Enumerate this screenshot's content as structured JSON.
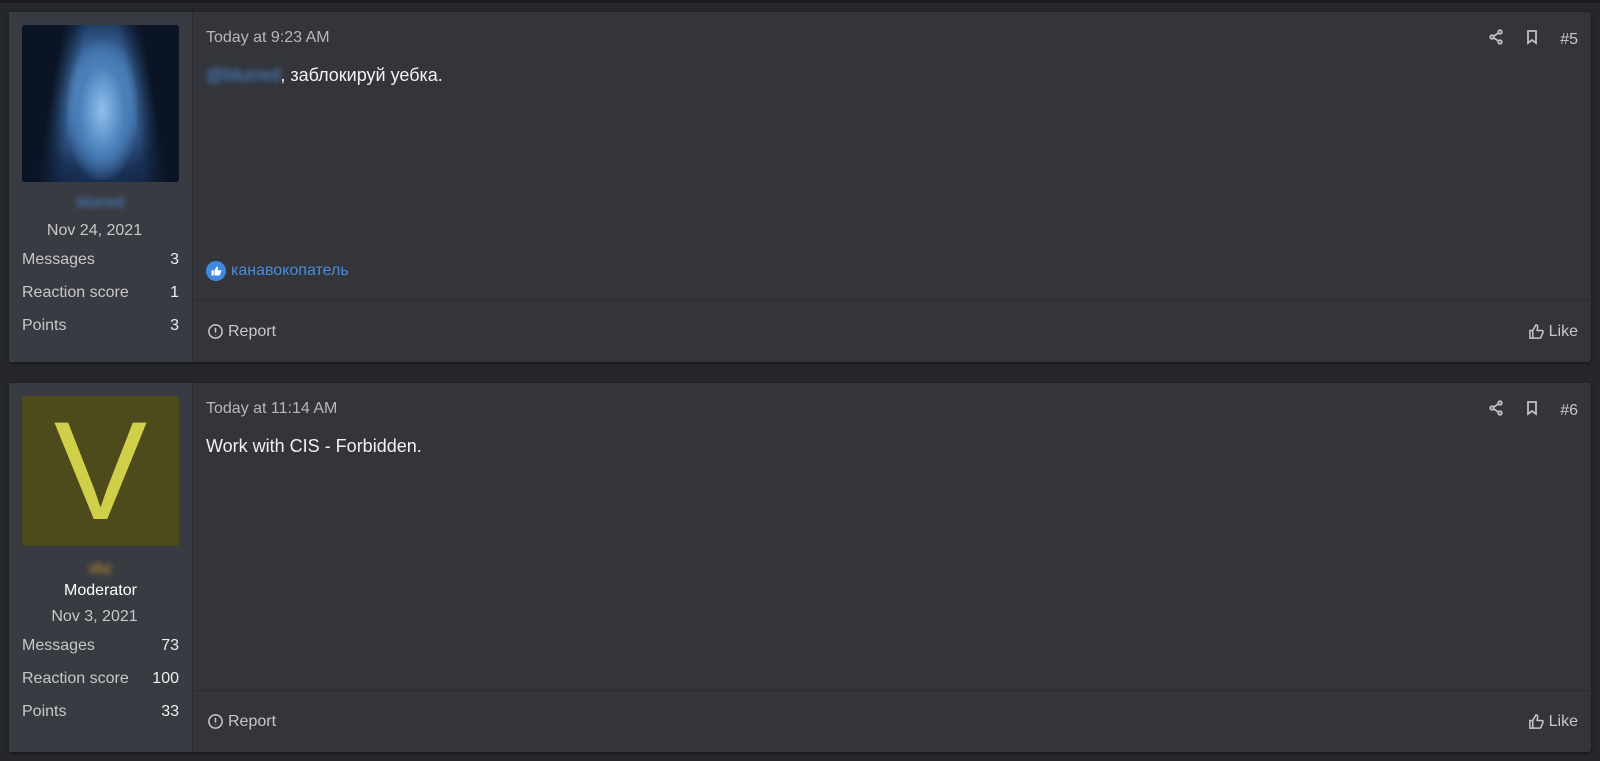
{
  "posts": [
    {
      "user": {
        "username": "blurred",
        "joined": "Nov 24, 2021",
        "stats": [
          {
            "label": "Messages",
            "value": "3"
          },
          {
            "label": "Reaction score",
            "value": "1"
          },
          {
            "label": "Points",
            "value": "3"
          }
        ]
      },
      "time": "Today at 9:23 AM",
      "number": "#5",
      "mention": "@blurred",
      "text": ", заблокируй уебка.",
      "reaction_user": "канавокопатель",
      "report_label": "Report",
      "like_label": "Like"
    },
    {
      "user": {
        "username": "vbz",
        "avatar_letter": "V",
        "role": "Moderator",
        "joined": "Nov 3, 2021",
        "stats": [
          {
            "label": "Messages",
            "value": "73"
          },
          {
            "label": "Reaction score",
            "value": "100"
          },
          {
            "label": "Points",
            "value": "33"
          }
        ]
      },
      "time": "Today at 11:14 AM",
      "number": "#6",
      "text": "Work with CIS - Forbidden.",
      "report_label": "Report",
      "like_label": "Like"
    }
  ]
}
